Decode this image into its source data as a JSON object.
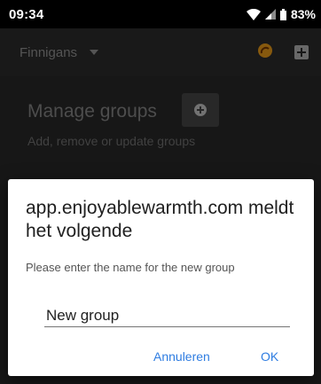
{
  "status_bar": {
    "time": "09:34",
    "battery_percent": "83%"
  },
  "app_bar": {
    "title": "Finnigans"
  },
  "manage": {
    "heading": "Manage groups",
    "subtitle": "Add, remove or update groups"
  },
  "dialog": {
    "title": "app.enjoyablewarmth.com meldt het volgende",
    "message": "Please enter the name for the new group",
    "input_value": "New group",
    "cancel_label": "Annuleren",
    "ok_label": "OK"
  },
  "colors": {
    "accent": "#2f7de1",
    "flame": "#f4a21b"
  }
}
